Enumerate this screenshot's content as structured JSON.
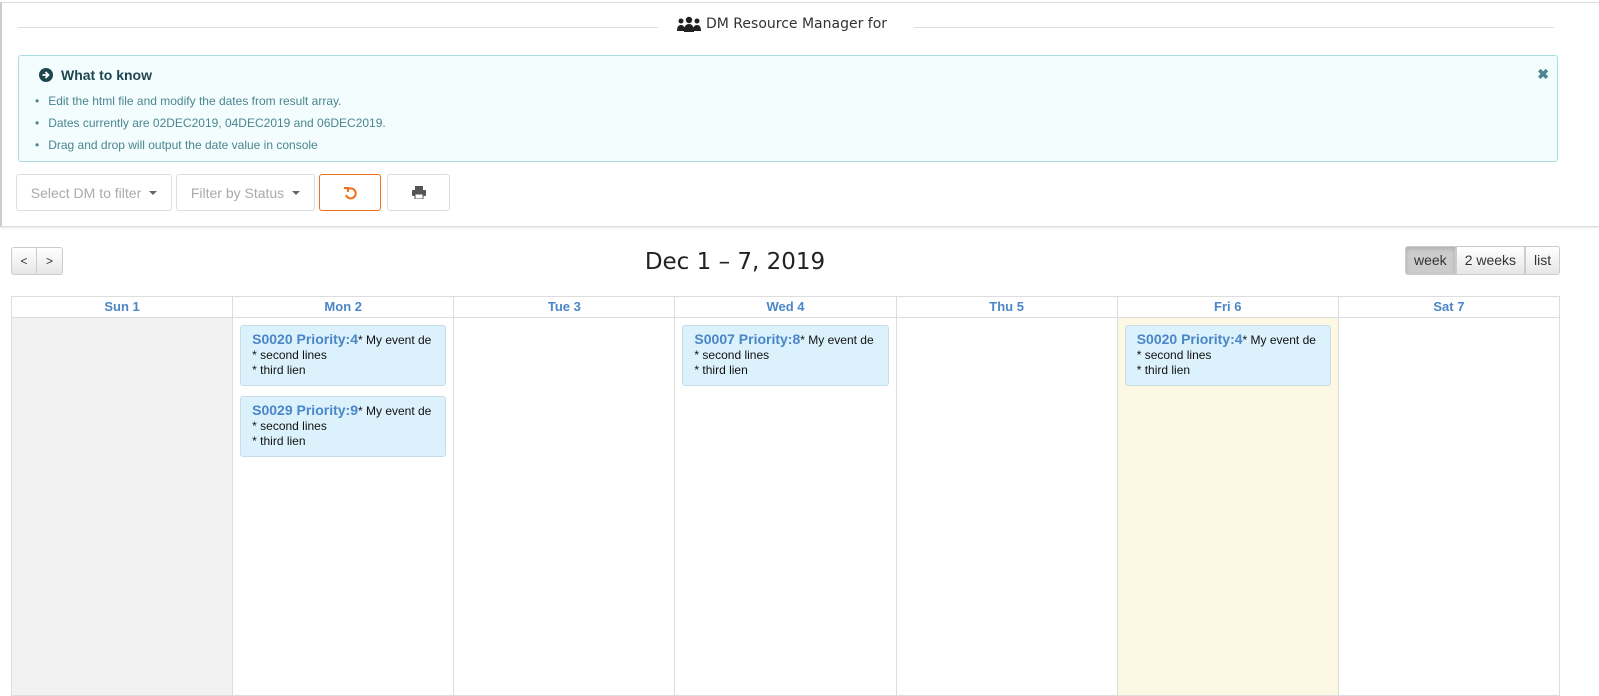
{
  "header": {
    "title": "DM Resource Manager for",
    "icon": "users-icon"
  },
  "alert": {
    "title": "What to know",
    "items": [
      "Edit the html file and modify the dates from result array.",
      "Dates currently are 02DEC2019, 04DEC2019 and 06DEC2019.",
      "Drag and drop will output the date value in console"
    ],
    "close": "✖"
  },
  "filters": {
    "dm_placeholder": "Select DM to filter",
    "status_placeholder": "Filter by Status"
  },
  "calendar": {
    "title": "Dec 1 – 7, 2019",
    "prev": "<",
    "next": ">",
    "views": [
      "week",
      "2 weeks",
      "list"
    ],
    "active_view": "week",
    "days": [
      {
        "label": "Sun 1",
        "events": []
      },
      {
        "label": "Mon 2",
        "events": [
          {
            "title": "S0020 Priority:4",
            "lines": [
              "* My event de",
              "* second lines",
              "* third lien"
            ]
          },
          {
            "title": "S0029 Priority:9",
            "lines": [
              "* My event de",
              "* second lines",
              "* third lien"
            ]
          }
        ]
      },
      {
        "label": "Tue 3",
        "events": []
      },
      {
        "label": "Wed 4",
        "events": [
          {
            "title": "S0007 Priority:8",
            "lines": [
              "* My event de",
              "* second lines",
              "* third lien"
            ]
          }
        ]
      },
      {
        "label": "Thu 5",
        "events": []
      },
      {
        "label": "Fri 6",
        "events": [
          {
            "title": "S0020 Priority:4",
            "lines": [
              "* My event de",
              "* second lines",
              "* third lien"
            ]
          }
        ]
      },
      {
        "label": "Sat 7",
        "events": []
      }
    ]
  },
  "colors": {
    "accent": "#4a86c8",
    "today": "#fcf8e3",
    "past": "#f2f2f2",
    "event": "#dbf1fc",
    "reset": "#f0701e"
  }
}
